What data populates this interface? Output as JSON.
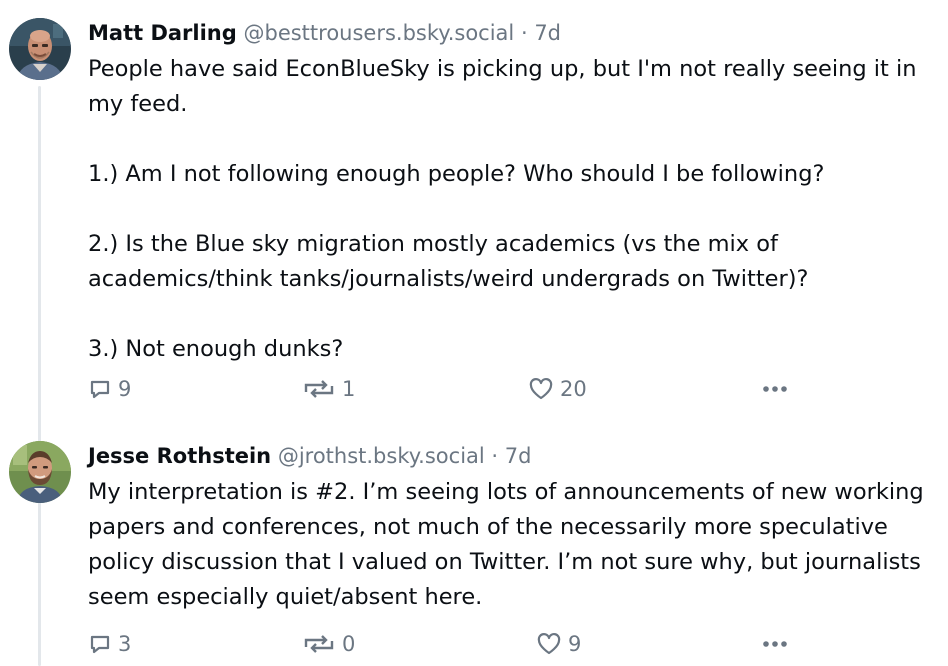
{
  "posts": [
    {
      "author_name": "Matt Darling",
      "author_handle": "@besttrousers.bsky.social",
      "separator": "·",
      "timestamp": "7d",
      "text_paragraphs": [
        "People have said EconBlueSky is picking up, but I'm not really seeing it in my feed.",
        "1.) Am I not following enough people? Who should I be following?",
        "2.) Is the Blue sky migration mostly academics (vs the mix of academics/think tanks/journalists/weird undergrads on Twitter)?",
        "3.) Not enough dunks?"
      ],
      "reply_count": "9",
      "repost_count": "1",
      "like_count": "20",
      "avatar_icon": "bald-man-avatar-icon"
    },
    {
      "author_name": "Jesse Rothstein",
      "author_handle": "@jrothst.bsky.social",
      "separator": "·",
      "timestamp": "7d",
      "text_paragraphs": [
        "My interpretation is #2. I’m seeing lots of announcements of new working papers and conferences, not much of the necessarily more speculative policy discussion that I valued on Twitter. I’m not sure why, but journalists seem especially quiet/absent here."
      ],
      "reply_count": "3",
      "repost_count": "0",
      "like_count": "9",
      "avatar_icon": "bearded-man-avatar-icon"
    }
  ],
  "icons": {
    "reply": "reply-bubble-icon",
    "repost": "repost-arrows-icon",
    "like": "heart-icon",
    "more": "more-dots-icon"
  },
  "colors": {
    "text": "#0b0f14",
    "muted": "#6b7682",
    "thread_line": "#e3e7eb"
  }
}
